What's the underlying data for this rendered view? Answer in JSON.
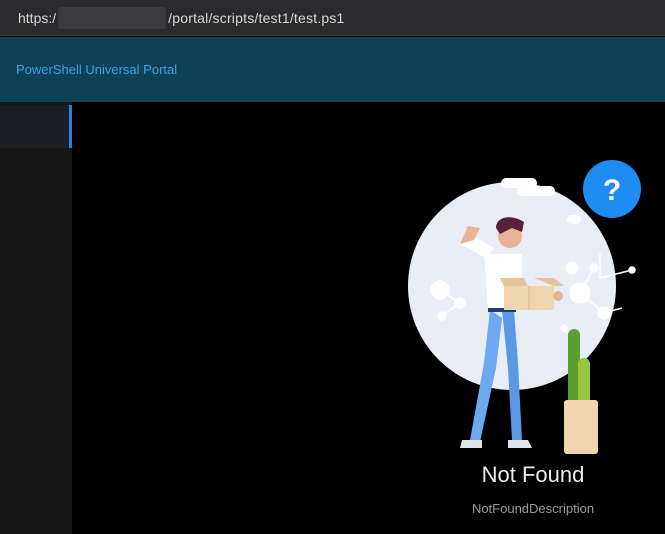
{
  "browser": {
    "url_prefix": "https:/",
    "url_path": "/portal/scripts/test1/test.ps1"
  },
  "header": {
    "title": "PowerShell Universal Portal"
  },
  "error": {
    "badge_symbol": "?",
    "title": "Not Found",
    "description": "NotFoundDescription"
  },
  "colors": {
    "appbar": "#0f4156",
    "title_link": "#3aa0e6",
    "badge": "#1e8cf0",
    "sidebar_active": "#2f7fd8"
  }
}
